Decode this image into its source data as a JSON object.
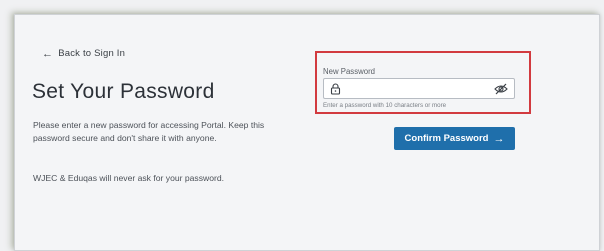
{
  "back_link": {
    "label": "Back to Sign In",
    "icon": "arrow-left-icon"
  },
  "title": "Set Your Password",
  "description": "Please enter a new password for accessing Portal. Keep this password secure and don't share it with anyone.",
  "note": "WJEC & Eduqas will never ask for your password.",
  "password_field": {
    "label": "New Password",
    "value": "",
    "placeholder": "",
    "hint": "Enter a password with 10 characters or more",
    "left_icon": "lock-icon",
    "right_icon": "eye-slash-icon"
  },
  "confirm_button": {
    "label": "Confirm Password",
    "icon": "arrow-right-icon"
  },
  "colors": {
    "button": "#1f6fab",
    "highlight": "#d23a3f",
    "background": "#f4f5f7"
  }
}
